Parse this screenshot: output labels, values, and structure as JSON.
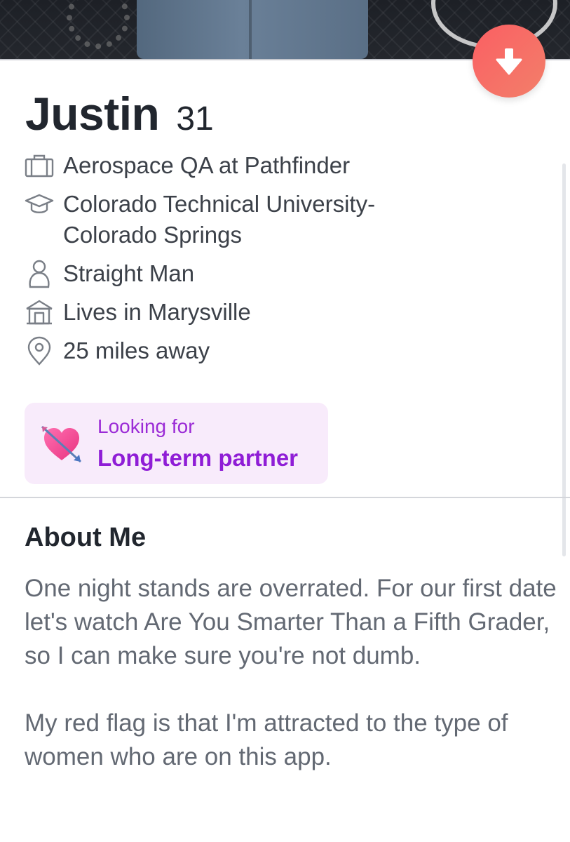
{
  "profile": {
    "name": "Justin",
    "age": "31",
    "details": [
      {
        "icon": "briefcase-icon",
        "text": "Aerospace QA at Pathfinder"
      },
      {
        "icon": "graduation-cap-icon",
        "text": "Colorado Technical University-\nColorado Springs"
      },
      {
        "icon": "person-icon",
        "text": "Straight Man"
      },
      {
        "icon": "house-icon",
        "text": "Lives in Marysville"
      },
      {
        "icon": "location-pin-icon",
        "text": "25 miles away"
      }
    ]
  },
  "looking_for": {
    "label": "Looking for",
    "value": "Long-term partner",
    "emoji": "heart-with-arrow-icon"
  },
  "about": {
    "heading": "About Me",
    "paragraphs": [
      "One night stands are overrated. For our first date let's watch Are You Smarter Than a Fifth Grader, so I can make sure you're not dumb.",
      "My red flag is that I'm attracted to the type of women who are on this app."
    ]
  },
  "actions": {
    "collapse_icon": "arrow-down-icon"
  },
  "colors": {
    "accent_gradient_start": "#fb5f63",
    "accent_gradient_end": "#f27f6a",
    "looking_card_bg": "#f8ebfb",
    "looking_text": "#8f1dd6"
  }
}
